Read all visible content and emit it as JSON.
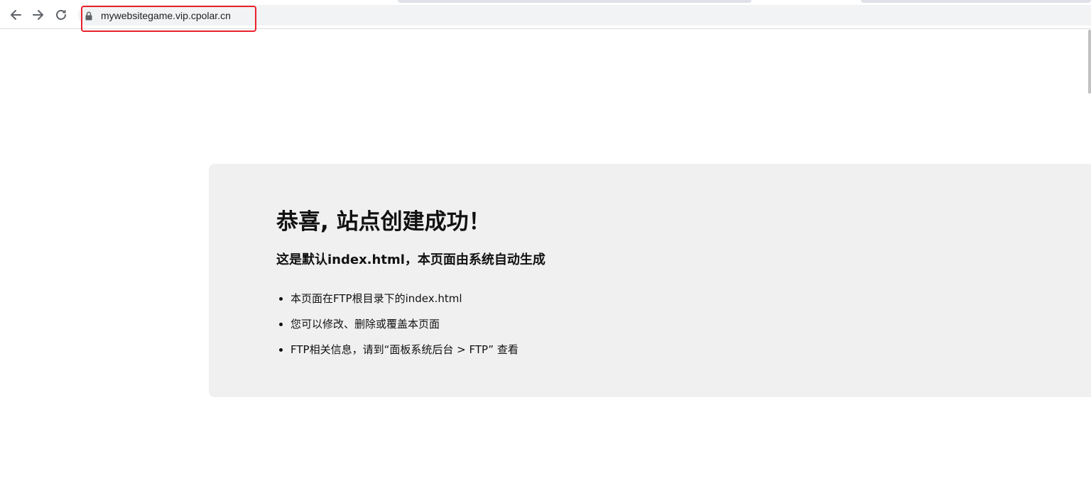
{
  "browser": {
    "url": "mywebsitegame.vip.cpolar.cn",
    "icons": {
      "back": "arrow-left-icon",
      "forward": "arrow-right-icon",
      "reload": "reload-icon",
      "lock": "lock-icon"
    },
    "colors": {
      "omnibox_bg": "#f1f3f4",
      "annotation_border": "#e8212b"
    }
  },
  "page": {
    "title": "恭喜, 站点创建成功！",
    "subtitle": "这是默认index.html，本页面由系统自动生成",
    "list_items": [
      "本页面在FTP根目录下的index.html",
      "您可以修改、删除或覆盖本页面",
      "FTP相关信息，请到“面板系统后台 > FTP” 查看"
    ],
    "colors": {
      "card_bg": "#f0f0f0",
      "text": "#111111"
    }
  }
}
